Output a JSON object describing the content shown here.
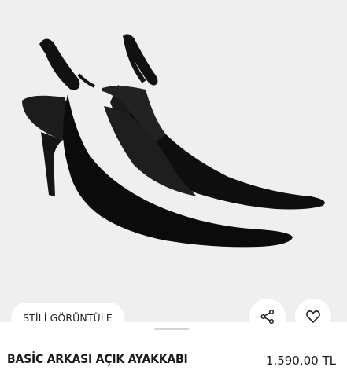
{
  "product": {
    "title": "BASİC ARKASI AÇIK AYAKKABI",
    "price": "1.590,00 TL",
    "image_alt": "black pointed-toe slingback heels"
  },
  "actions": {
    "style_label": "STİLİ GÖRÜNTÜLE",
    "share_icon": "share-icon",
    "favorite_icon": "heart-icon"
  },
  "colors": {
    "image_background": "#efefef",
    "shoe": "#111111",
    "text": "#1a1a1a"
  }
}
